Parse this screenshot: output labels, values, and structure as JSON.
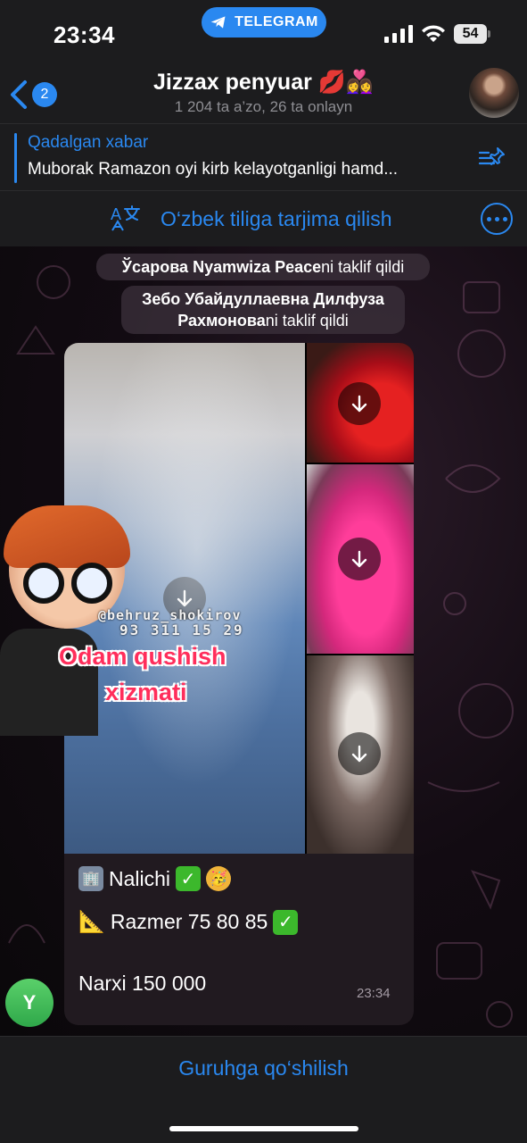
{
  "status_bar": {
    "time": "23:34",
    "pill_label": "TELEGRAM",
    "battery": "54",
    "icons": [
      "telegram-icon",
      "signal-icon",
      "wifi-icon",
      "battery-icon"
    ]
  },
  "header": {
    "back_count": "2",
    "title": "Jizzax penyuar 💋👩‍❤️‍👩",
    "subtitle": "1 204 ta a’zo, 26 ta onlayn"
  },
  "pinned": {
    "title": "Qadalgan xabar",
    "text": "Muborak Ramazon oyi kirb kelayotganligi hamd..."
  },
  "translate": {
    "label": "O‘zbek tiliga tarjima qilish"
  },
  "service_messages": [
    {
      "name": "Ўсарова Nyamwiza Peace",
      "action": "ni taklif qildi"
    },
    {
      "name": "Зебо Убайдуллаевна Дилфуза Рахмонова",
      "action": "ni taklif qildi"
    }
  ],
  "sticker": {
    "handle": "@behruz_shokirov",
    "phone": "93 311 15 29",
    "line1": "Odam qushish",
    "line2": "xizmati"
  },
  "message": {
    "line1": "Nalichi",
    "line2": "Razmer 75 80 85",
    "line3": "Narxi 150 000",
    "time": "23:34",
    "sender_initial": "Y"
  },
  "footer": {
    "join_label": "Guruhga qo‘shilish"
  },
  "colors": {
    "accent": "#2a88f0",
    "bar_bg": "#1c1c1e"
  }
}
